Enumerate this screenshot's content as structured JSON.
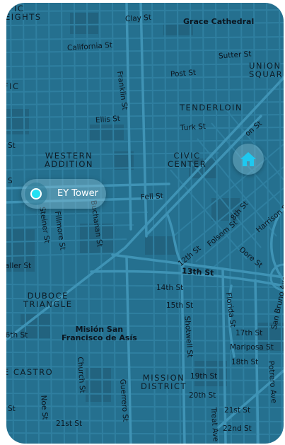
{
  "map": {
    "labels": [
      {
        "id": "heights",
        "text": "IFIC\nEIGHTS"
      },
      {
        "id": "clay-st",
        "text": "Clay St"
      },
      {
        "id": "grace-cathedral",
        "text": "Grace Cathedral"
      },
      {
        "id": "california-st",
        "text": "California St"
      },
      {
        "id": "sutter-st",
        "text": "Sutter St"
      },
      {
        "id": "union-square",
        "text": "UNION\nSQUAR"
      },
      {
        "id": "post-st",
        "text": "Post St"
      },
      {
        "id": "franklin-st",
        "text": "Franklin St"
      },
      {
        "id": "fic",
        "text": "FIC"
      },
      {
        "id": "ellis-st",
        "text": "Ellis St"
      },
      {
        "id": "tenderloin",
        "text": "TENDERLOIN"
      },
      {
        "id": "turk-st",
        "text": "Turk St"
      },
      {
        "id": "st-left",
        "text": "St"
      },
      {
        "id": "western-addition",
        "text": "WESTERN\nADDITION"
      },
      {
        "id": "civic-center",
        "text": "CIVIC\nCENTER"
      },
      {
        "id": "on-st",
        "text": "on St"
      },
      {
        "id": "s-left",
        "text": "S"
      },
      {
        "id": "fell-st",
        "text": "Fell St"
      },
      {
        "id": "steiner-st",
        "text": "Steiner St"
      },
      {
        "id": "fillmore-st",
        "text": "Fillmore St"
      },
      {
        "id": "buchanan-st",
        "text": "Buchanan St"
      },
      {
        "id": "8th-st",
        "text": "8th St"
      },
      {
        "id": "folsom-st",
        "text": "Folsom St"
      },
      {
        "id": "harrison-st",
        "text": "Harrison St"
      },
      {
        "id": "12th-st",
        "text": "12th St"
      },
      {
        "id": "dore-st",
        "text": "Dore St"
      },
      {
        "id": "waller-st",
        "text": "aller St"
      },
      {
        "id": "13th-st",
        "text": "13th St"
      },
      {
        "id": "14th-st",
        "text": "14th St"
      },
      {
        "id": "duboce-triangle",
        "text": "DUBOCE\nTRIANGLE"
      },
      {
        "id": "15th-st",
        "text": "15th St"
      },
      {
        "id": "florida-st",
        "text": "Florida St"
      },
      {
        "id": "san-bruno-ave",
        "text": "San Bruno Ave"
      },
      {
        "id": "shotwell-st",
        "text": "Shotwell St"
      },
      {
        "id": "16th-st",
        "text": "16th St"
      },
      {
        "id": "mision-san-francisco",
        "text": "Misión San\nFrancisco de Asís"
      },
      {
        "id": "17th-st",
        "text": "17th St"
      },
      {
        "id": "mariposa-st",
        "text": "Mariposa St"
      },
      {
        "id": "18th-st",
        "text": "18th St"
      },
      {
        "id": "castro",
        "text": "E CASTRO"
      },
      {
        "id": "church-st",
        "text": "Church St"
      },
      {
        "id": "mission-district",
        "text": "MISSION\nDISTRICT"
      },
      {
        "id": "19th-st",
        "text": "19th St"
      },
      {
        "id": "potrero-ave",
        "text": "Potrero Ave"
      },
      {
        "id": "20th-st",
        "text": "20th St"
      },
      {
        "id": "st-bottom-left",
        "text": "St"
      },
      {
        "id": "noe-st",
        "text": "Noe St"
      },
      {
        "id": "guerrero-st",
        "text": "Guerrero St"
      },
      {
        "id": "21st-st-right",
        "text": "21st St"
      },
      {
        "id": "21st-st-left",
        "text": "21st St"
      },
      {
        "id": "treat-ave",
        "text": "Treat Ave"
      },
      {
        "id": "22nd-st",
        "text": "22nd St"
      }
    ]
  },
  "markers": {
    "home_icon": "home-icon",
    "location_name": "EY Tower",
    "location_dot_color": "#21e0f2",
    "home_icon_color": "#1ec8f0"
  },
  "colors": {
    "water": "#25708f",
    "street": "#3a8db0",
    "arterial": "#4698ba",
    "block": "#215f7a",
    "label": "#0b1620"
  }
}
